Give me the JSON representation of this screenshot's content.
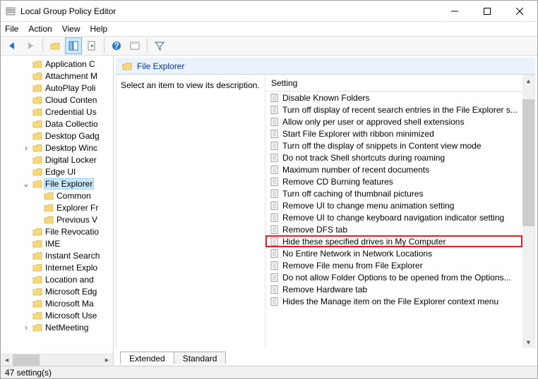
{
  "window": {
    "title": "Local Group Policy Editor"
  },
  "menu": [
    "File",
    "Action",
    "View",
    "Help"
  ],
  "sidebar": {
    "selected_label": "File Explorer",
    "items": [
      {
        "expander": "",
        "indent": 1,
        "label": "Application C"
      },
      {
        "expander": "",
        "indent": 1,
        "label": "Attachment M"
      },
      {
        "expander": "",
        "indent": 1,
        "label": "AutoPlay Poli"
      },
      {
        "expander": "",
        "indent": 1,
        "label": "Cloud Conten"
      },
      {
        "expander": "",
        "indent": 1,
        "label": "Credential Us"
      },
      {
        "expander": "",
        "indent": 1,
        "label": "Data Collectio"
      },
      {
        "expander": "",
        "indent": 1,
        "label": "Desktop Gadg"
      },
      {
        "expander": ">",
        "indent": 1,
        "label": "Desktop Winc"
      },
      {
        "expander": "",
        "indent": 1,
        "label": "Digital Locker"
      },
      {
        "expander": "",
        "indent": 1,
        "label": "Edge UI"
      },
      {
        "expander": "v",
        "indent": 1,
        "label": "File Explorer",
        "selected": true
      },
      {
        "expander": "",
        "indent": 2,
        "label": "Common"
      },
      {
        "expander": "",
        "indent": 2,
        "label": "Explorer Fr"
      },
      {
        "expander": "",
        "indent": 2,
        "label": "Previous V"
      },
      {
        "expander": "",
        "indent": 1,
        "label": "File Revocatio"
      },
      {
        "expander": "",
        "indent": 1,
        "label": "IME"
      },
      {
        "expander": "",
        "indent": 1,
        "label": "Instant Search"
      },
      {
        "expander": "",
        "indent": 1,
        "label": "Internet Explo"
      },
      {
        "expander": "",
        "indent": 1,
        "label": "Location and"
      },
      {
        "expander": "",
        "indent": 1,
        "label": "Microsoft Edg"
      },
      {
        "expander": "",
        "indent": 1,
        "label": "Microsoft Ma"
      },
      {
        "expander": "",
        "indent": 1,
        "label": "Microsoft Use"
      },
      {
        "expander": ">",
        "indent": 1,
        "label": "NetMeeting"
      }
    ]
  },
  "right": {
    "header_title": "File Explorer",
    "description_prompt": "Select an item to view its description.",
    "column_header": "Setting",
    "settings": [
      "Disable Known Folders",
      "Turn off display of recent search entries in the File Explorer s...",
      "Allow only per user or approved shell extensions",
      "Start File Explorer with ribbon minimized",
      "Turn off the display of snippets in Content view mode",
      "Do not track Shell shortcuts during roaming",
      "Maximum number of recent documents",
      "Remove CD Burning features",
      "Turn off caching of thumbnail pictures",
      "Remove UI to change menu animation setting",
      "Remove UI to change keyboard navigation indicator setting",
      "Remove DFS tab",
      "Hide these specified drives in My Computer",
      "No Entire Network in Network Locations",
      "Remove File menu from File Explorer",
      "Do not allow Folder Options to be opened from the Options...",
      "Remove Hardware tab",
      "Hides the Manage item on the File Explorer context menu"
    ],
    "highlighted_index": 12,
    "tabs": [
      "Extended",
      "Standard"
    ]
  },
  "status": "47 setting(s)"
}
